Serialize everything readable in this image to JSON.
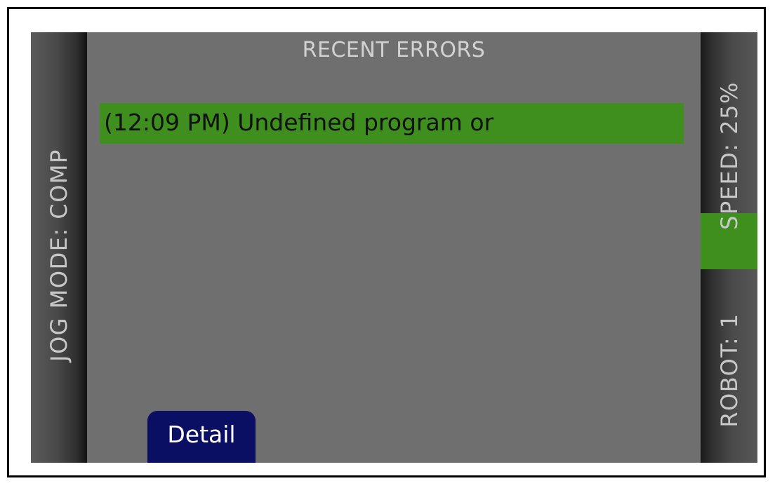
{
  "left_panel": {
    "jog_mode_label": "JOG MODE: COMP"
  },
  "main": {
    "title": "RECENT ERRORS",
    "errors": [
      {
        "text": "(12:09 PM) Undefined program or",
        "selected": true
      }
    ],
    "detail_button_label": "Detail"
  },
  "right_panel": {
    "speed_label": "SPEED: 25%",
    "robot_label": "ROBOT: 1"
  },
  "colors": {
    "selection": "#3f8f1f",
    "button": "#0a0f63",
    "screen_bg": "#6f6f6f"
  }
}
